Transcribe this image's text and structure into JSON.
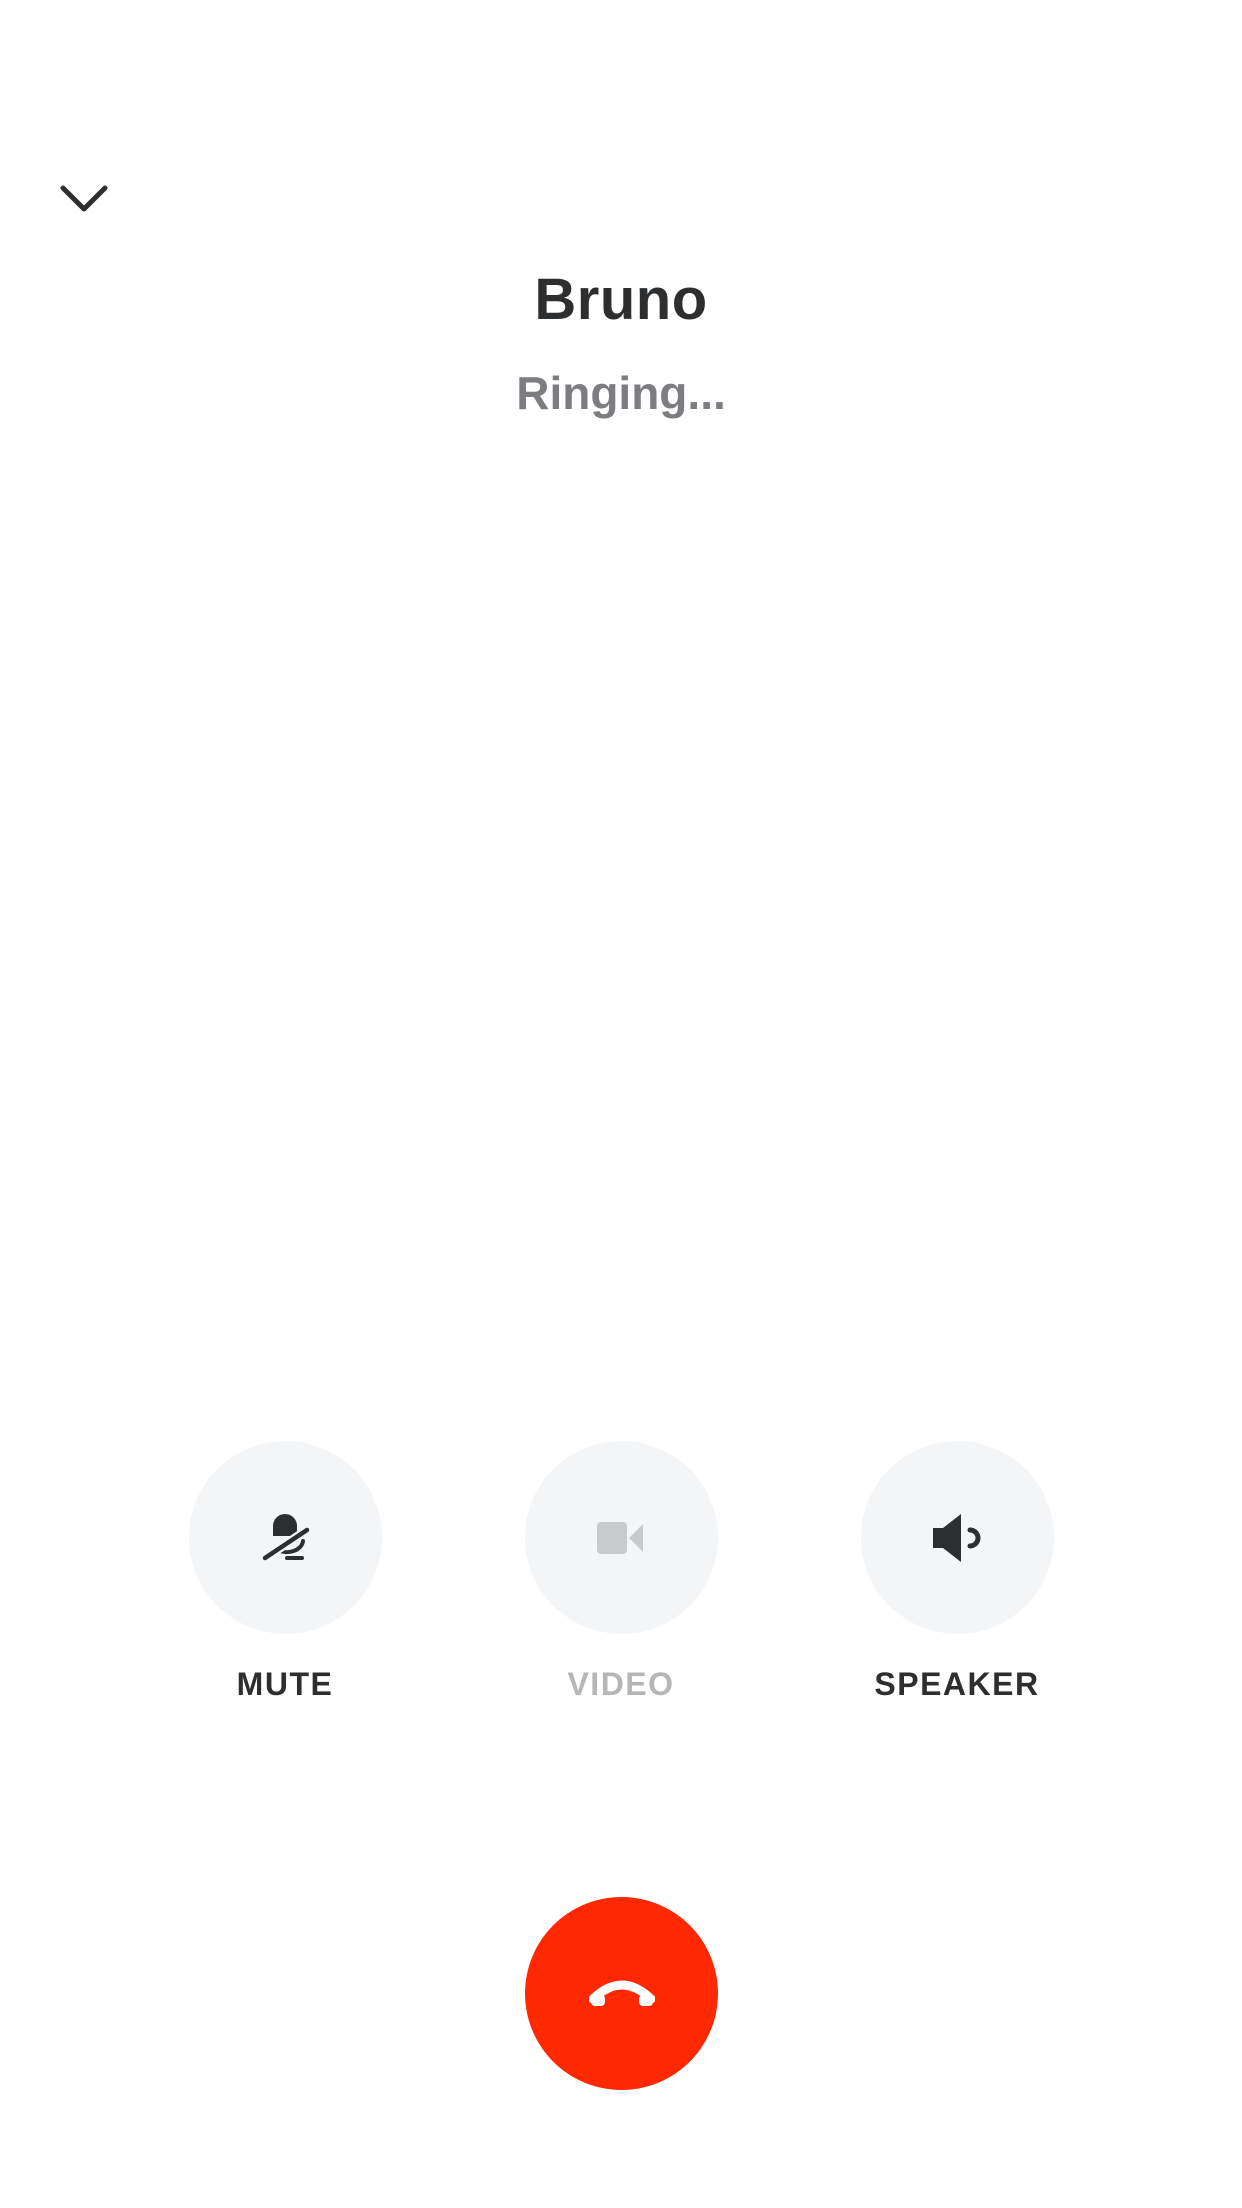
{
  "header": {
    "caller_name": "Bruno",
    "status": "Ringing..."
  },
  "controls": [
    {
      "label": "MUTE",
      "icon": "mic-off-icon",
      "enabled": true
    },
    {
      "label": "VIDEO",
      "icon": "video-camera-icon",
      "enabled": false
    },
    {
      "label": "SPEAKER",
      "icon": "speaker-icon",
      "enabled": true
    }
  ],
  "end_call": {
    "icon": "hang-up-icon"
  },
  "colors": {
    "end_call": "#ff2800",
    "control_bg": "#f4f5f7",
    "text_primary": "#2d2e30",
    "text_secondary": "#7c7d80",
    "text_disabled": "#b5b6b8"
  }
}
